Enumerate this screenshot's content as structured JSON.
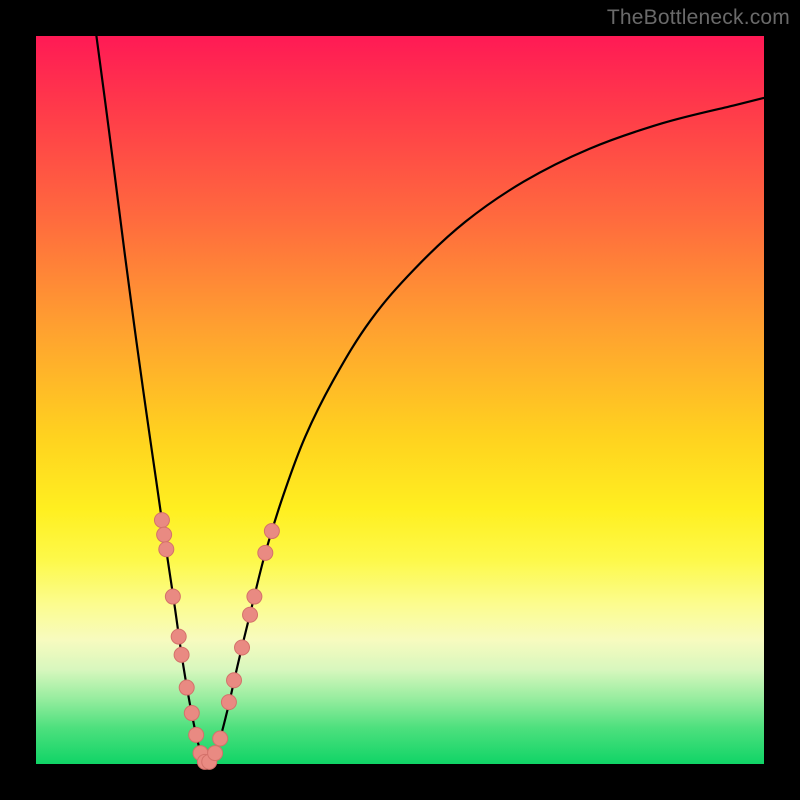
{
  "watermark": "TheBottleneck.com",
  "chart_data": {
    "type": "line",
    "title": "",
    "xlabel": "",
    "ylabel": "",
    "xlim": [
      0,
      1
    ],
    "ylim": [
      0,
      1
    ],
    "notes": "Axes unlabeled. Gradient background red→yellow→green top-to-bottom. V-shaped black curve with minimum near x≈0.23, y≈0; right branch rises with gentle curvature to top-right. Salmon-colored 'bead' markers clustered near the bottom of the V between y≈0 and y≈0.30.",
    "series": [
      {
        "name": "left-branch",
        "type": "line",
        "points": [
          {
            "x": 0.083,
            "y": 1.0
          },
          {
            "x": 0.095,
            "y": 0.91
          },
          {
            "x": 0.108,
            "y": 0.81
          },
          {
            "x": 0.122,
            "y": 0.7
          },
          {
            "x": 0.138,
            "y": 0.58
          },
          {
            "x": 0.152,
            "y": 0.48
          },
          {
            "x": 0.165,
            "y": 0.39
          },
          {
            "x": 0.178,
            "y": 0.3
          },
          {
            "x": 0.19,
            "y": 0.22
          },
          {
            "x": 0.2,
            "y": 0.15
          },
          {
            "x": 0.21,
            "y": 0.09
          },
          {
            "x": 0.22,
            "y": 0.04
          },
          {
            "x": 0.228,
            "y": 0.01
          },
          {
            "x": 0.235,
            "y": 0.0
          }
        ]
      },
      {
        "name": "right-branch",
        "type": "line",
        "points": [
          {
            "x": 0.235,
            "y": 0.0
          },
          {
            "x": 0.248,
            "y": 0.02
          },
          {
            "x": 0.262,
            "y": 0.07
          },
          {
            "x": 0.278,
            "y": 0.14
          },
          {
            "x": 0.295,
            "y": 0.21
          },
          {
            "x": 0.315,
            "y": 0.29
          },
          {
            "x": 0.34,
            "y": 0.37
          },
          {
            "x": 0.37,
            "y": 0.45
          },
          {
            "x": 0.41,
            "y": 0.53
          },
          {
            "x": 0.46,
            "y": 0.61
          },
          {
            "x": 0.52,
            "y": 0.68
          },
          {
            "x": 0.59,
            "y": 0.745
          },
          {
            "x": 0.67,
            "y": 0.8
          },
          {
            "x": 0.76,
            "y": 0.845
          },
          {
            "x": 0.86,
            "y": 0.88
          },
          {
            "x": 0.96,
            "y": 0.905
          },
          {
            "x": 1.0,
            "y": 0.915
          }
        ]
      },
      {
        "name": "markers",
        "type": "scatter",
        "points": [
          {
            "x": 0.173,
            "y": 0.335
          },
          {
            "x": 0.176,
            "y": 0.315
          },
          {
            "x": 0.179,
            "y": 0.295
          },
          {
            "x": 0.188,
            "y": 0.23
          },
          {
            "x": 0.196,
            "y": 0.175
          },
          {
            "x": 0.2,
            "y": 0.15
          },
          {
            "x": 0.207,
            "y": 0.105
          },
          {
            "x": 0.214,
            "y": 0.07
          },
          {
            "x": 0.22,
            "y": 0.04
          },
          {
            "x": 0.226,
            "y": 0.015
          },
          {
            "x": 0.232,
            "y": 0.003
          },
          {
            "x": 0.238,
            "y": 0.003
          },
          {
            "x": 0.246,
            "y": 0.015
          },
          {
            "x": 0.253,
            "y": 0.035
          },
          {
            "x": 0.265,
            "y": 0.085
          },
          {
            "x": 0.272,
            "y": 0.115
          },
          {
            "x": 0.283,
            "y": 0.16
          },
          {
            "x": 0.294,
            "y": 0.205
          },
          {
            "x": 0.3,
            "y": 0.23
          },
          {
            "x": 0.315,
            "y": 0.29
          },
          {
            "x": 0.324,
            "y": 0.32
          }
        ]
      }
    ],
    "colors": {
      "curve": "#000000",
      "marker_fill": "#e98a82",
      "marker_stroke": "#d4716a",
      "gradient_top": "#ff1a55",
      "gradient_mid": "#ffd21f",
      "gradient_bottom": "#10d466"
    }
  }
}
